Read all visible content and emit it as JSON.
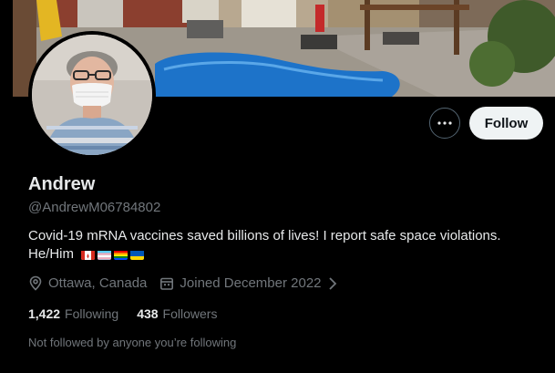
{
  "profile": {
    "name": "Andrew",
    "handle": "@AndrewM06784802",
    "bio": "Covid-19 mRNA vaccines saved billions of lives! I report safe space violations. He/Him",
    "bio_flags": [
      "canada-flag",
      "transgender-flag",
      "rainbow-flag",
      "ukraine-flag"
    ],
    "location": "Ottawa, Canada",
    "joined": "Joined December 2022",
    "following_count": "1,422",
    "following_label": "Following",
    "followers_count": "438",
    "followers_label": "Followers",
    "followed_note": "Not followed by anyone you’re following"
  },
  "actions": {
    "more_label": "···",
    "follow_label": "Follow"
  },
  "icons": {
    "location": "location-pin-icon",
    "calendar": "calendar-icon",
    "more": "more-dots-icon",
    "chevron": "chevron-right-icon"
  },
  "colors": {
    "background": "#000000",
    "primary_text": "#e7e9ea",
    "secondary_text": "#71767b",
    "follow_button": "#eff3f4"
  }
}
